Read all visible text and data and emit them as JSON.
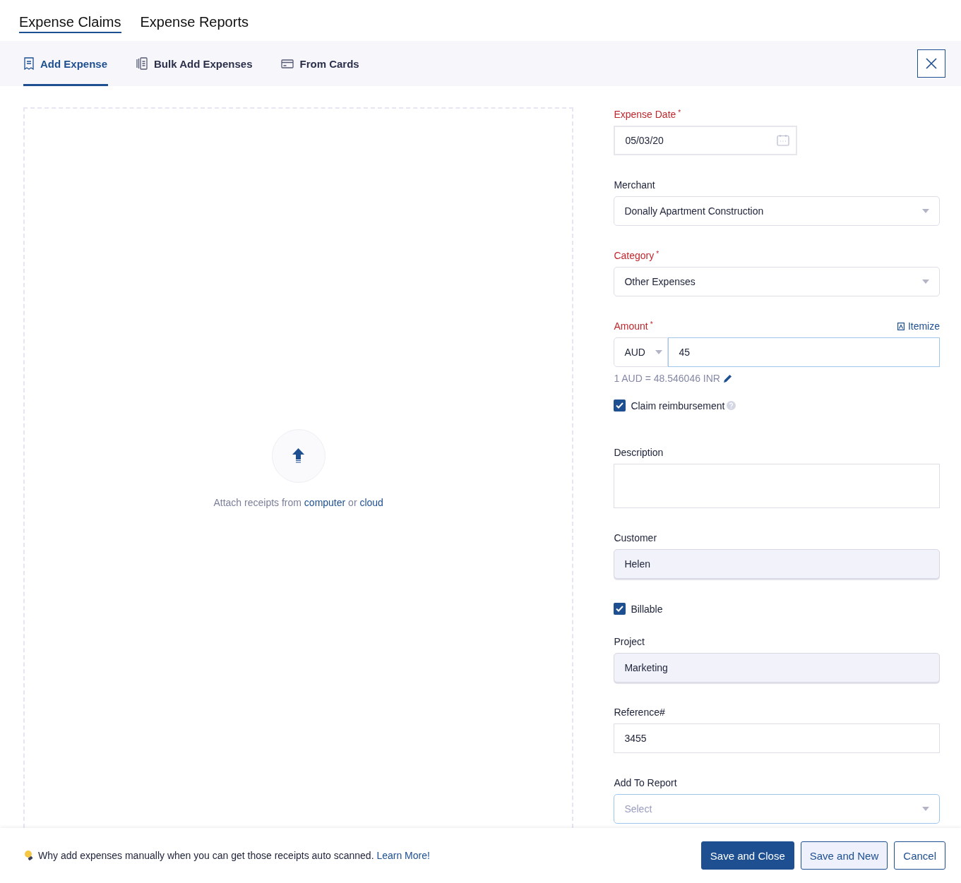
{
  "top_tabs": [
    {
      "label": "Expense Claims",
      "selected": true
    },
    {
      "label": "Expense Reports",
      "selected": false
    }
  ],
  "sub_tabs": [
    {
      "label": "Add Expense",
      "selected": true
    },
    {
      "label": "Bulk Add Expenses",
      "selected": false
    },
    {
      "label": "From Cards",
      "selected": false
    }
  ],
  "upload": {
    "text": "Attach receipts from",
    "link_1": "computer",
    "separator": "or",
    "link_2": "cloud"
  },
  "fields": [
    {
      "kind": "date",
      "label": "Expense Date",
      "required_mark": "*",
      "value": "05/03/20"
    },
    {
      "kind": "select",
      "label": "Merchant",
      "value": "Donally Apartment Construction"
    },
    {
      "kind": "select",
      "label": "Category",
      "required_mark": "*",
      "value": "Other Expenses"
    },
    {
      "kind": "amount",
      "label": "Amount",
      "required_mark": "*",
      "link": "Itemize",
      "currency": "AUD",
      "value": "45",
      "focused": true,
      "rate": "1 AUD = 48.546046 INR"
    },
    {
      "kind": "checkbox",
      "label": "Claim reimbursement",
      "checked": true,
      "help": true
    },
    {
      "kind": "textarea",
      "label": "Description"
    },
    {
      "kind": "text",
      "label": "Customer",
      "value": "Helen",
      "disabled": true
    },
    {
      "kind": "checkbox",
      "label": "Billable",
      "checked": true
    },
    {
      "kind": "text",
      "label": "Project",
      "value": "Marketing",
      "disabled": true
    },
    {
      "kind": "text",
      "label": "Reference#",
      "value": "3455",
      "disabled": false
    },
    {
      "kind": "select",
      "label": "Add To Report",
      "placeholder": "Select",
      "focused": true
    }
  ],
  "footer": {
    "tip": "Why add expenses manually when you can get those receipts auto scanned.",
    "tip_link": "Learn More!",
    "buttons": [
      {
        "label": "Save and Close",
        "kind": "primary"
      },
      {
        "label": "Save and New",
        "kind": "secondary"
      },
      {
        "label": "Cancel",
        "kind": "outline"
      }
    ]
  }
}
